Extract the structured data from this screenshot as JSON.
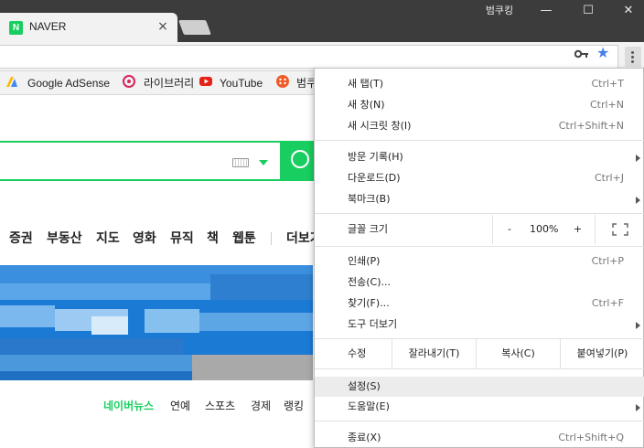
{
  "window": {
    "profile_name": "범쿠킹",
    "minimize": "—",
    "maximize": "☐",
    "close": "✕"
  },
  "tab": {
    "favicon_letter": "N",
    "title": "NAVER",
    "close": "×"
  },
  "bookmarks": [
    {
      "label": "Google AdSense",
      "icon": "adsense-icon"
    },
    {
      "label": "라이브러리",
      "icon": "library-icon"
    },
    {
      "label": "YouTube",
      "icon": "youtube-icon"
    },
    {
      "label": "범쿠",
      "icon": "bookmark-app-icon"
    }
  ],
  "page": {
    "nav_items": [
      "증권",
      "부동산",
      "지도",
      "영화",
      "뮤직",
      "책",
      "웹툰",
      "더보기"
    ],
    "news_tabs": [
      "네이버뉴스",
      "연예",
      "스포츠",
      "경제",
      "랭킹"
    ],
    "accent_color": "#19ce60"
  },
  "menu": {
    "new_tab": {
      "label": "새 탭(T)",
      "shortcut": "Ctrl+T"
    },
    "new_window": {
      "label": "새 창(N)",
      "shortcut": "Ctrl+N"
    },
    "new_incognito": {
      "label": "새 시크릿 창(I)",
      "shortcut": "Ctrl+Shift+N"
    },
    "history": {
      "label": "방문 기록(H)"
    },
    "downloads": {
      "label": "다운로드(D)",
      "shortcut": "Ctrl+J"
    },
    "bookmarks": {
      "label": "북마크(B)"
    },
    "zoom": {
      "label": "글꼴 크기",
      "minus": "-",
      "value": "100%",
      "plus": "+"
    },
    "print": {
      "label": "인쇄(P)",
      "shortcut": "Ctrl+P"
    },
    "cast": {
      "label": "전송(C)..."
    },
    "find": {
      "label": "찾기(F)...",
      "shortcut": "Ctrl+F"
    },
    "more_tools": {
      "label": "도구 더보기"
    },
    "edit": {
      "label": "수정",
      "cut": "잘라내기(T)",
      "copy": "복사(C)",
      "paste": "붙여넣기(P)"
    },
    "settings": {
      "label": "설정(S)"
    },
    "help": {
      "label": "도움말(E)"
    },
    "exit": {
      "label": "종료(X)",
      "shortcut": "Ctrl+Shift+Q"
    }
  }
}
